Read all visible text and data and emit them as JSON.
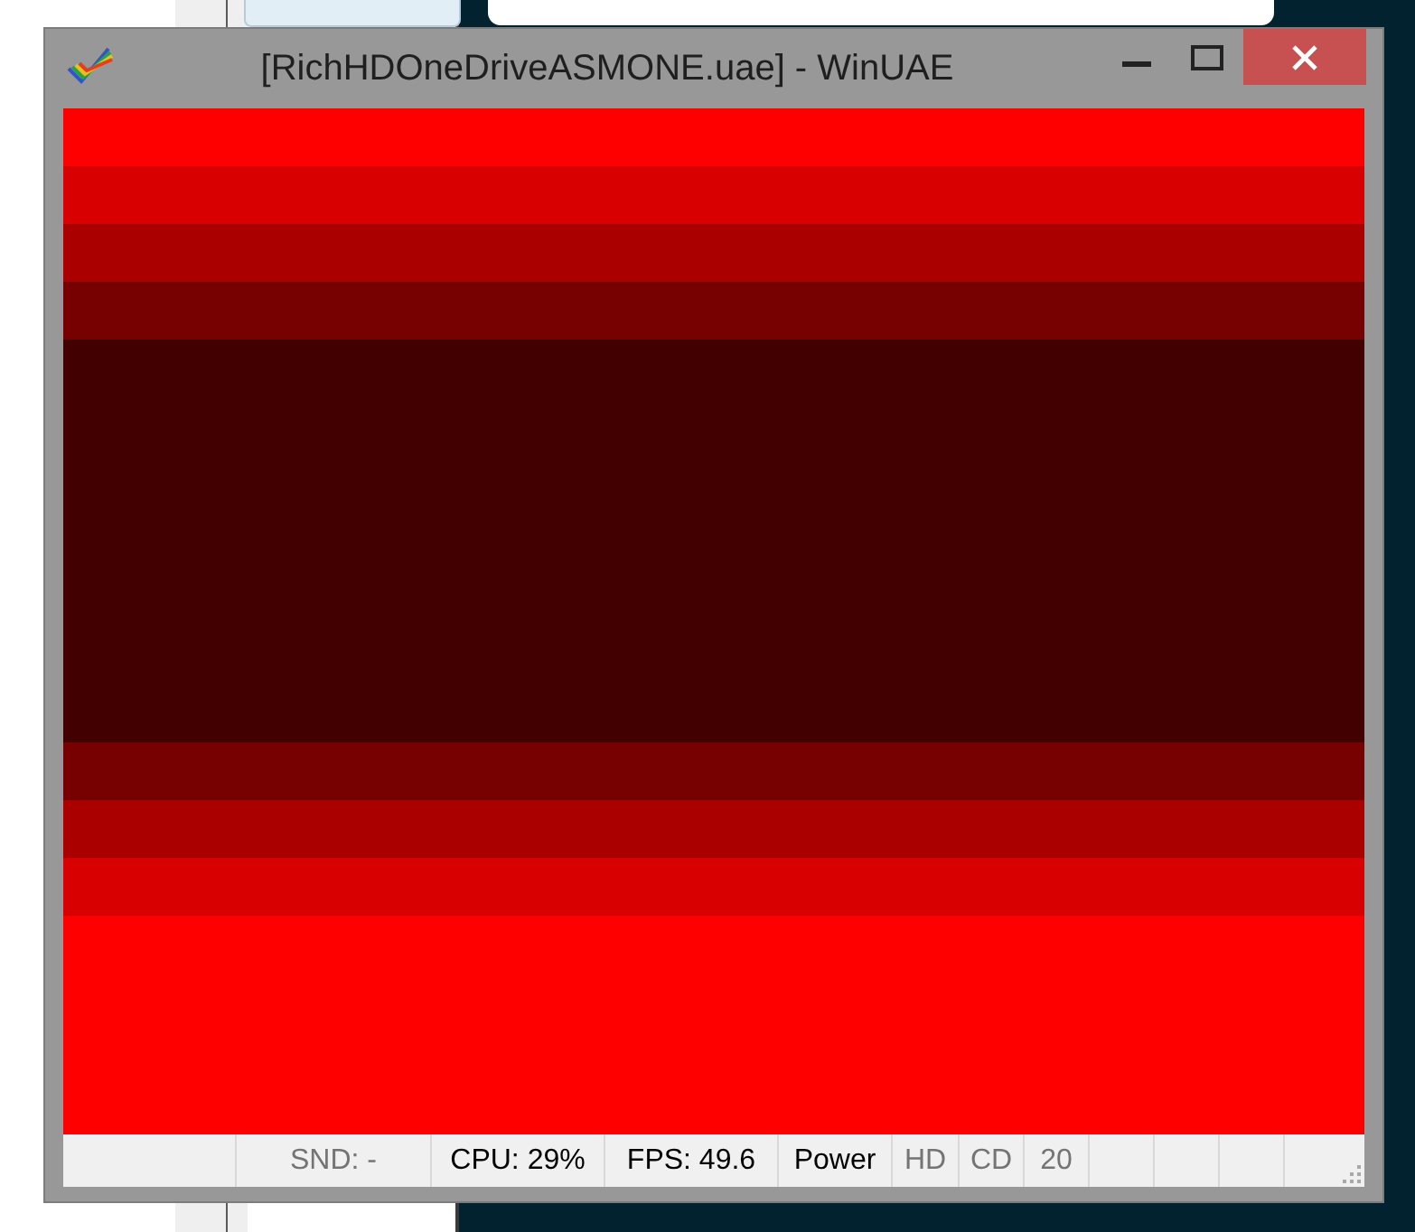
{
  "window": {
    "title": "[RichHDOneDriveASMONE.uae] - WinUAE"
  },
  "status_bar": {
    "cells": [
      {
        "kind": "blank"
      },
      {
        "kind": "text",
        "text": "SND: -",
        "active": false
      },
      {
        "kind": "text",
        "text": "CPU: 29%",
        "active": true
      },
      {
        "kind": "text",
        "text": "FPS: 49.6",
        "active": true
      },
      {
        "kind": "text",
        "text": "Power",
        "active": true
      },
      {
        "kind": "text",
        "text": "HD",
        "active": false
      },
      {
        "kind": "text",
        "text": "CD",
        "active": false
      },
      {
        "kind": "text",
        "text": "20",
        "active": false
      },
      {
        "kind": "blank"
      },
      {
        "kind": "blank"
      },
      {
        "kind": "blank"
      },
      {
        "kind": "blank"
      }
    ]
  }
}
